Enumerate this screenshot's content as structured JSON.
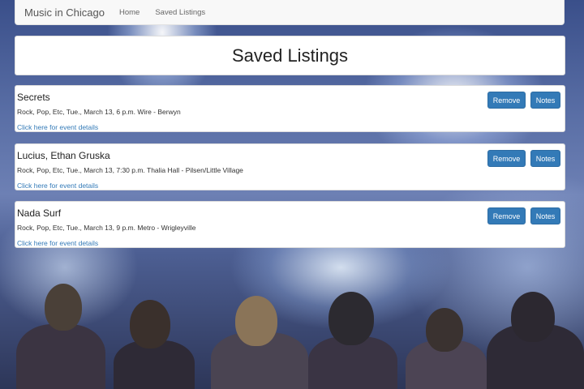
{
  "navbar": {
    "brand": "Music in Chicago",
    "links": [
      "Home",
      "Saved Listings"
    ]
  },
  "page_title": "Saved Listings",
  "listings": [
    {
      "name": "Secrets",
      "details": "Rock, Pop, Etc, Tue., March 13, 6 p.m. Wire - Berwyn",
      "link_text": "Click here for event details",
      "remove_label": "Remove",
      "notes_label": "Notes"
    },
    {
      "name": "Lucius, Ethan Gruska",
      "details": "Rock, Pop, Etc, Tue., March 13, 7:30 p.m. Thalia Hall - Pilsen/Little Village",
      "link_text": "Click here for event details",
      "remove_label": "Remove",
      "notes_label": "Notes"
    },
    {
      "name": "Nada Surf",
      "details": "Rock, Pop, Etc, Tue., March 13, 9 p.m. Metro - Wrigleyville",
      "link_text": "Click here for event details",
      "remove_label": "Remove",
      "notes_label": "Notes"
    }
  ],
  "colors": {
    "button_primary": "#337ab7",
    "link": "#337ab7",
    "navbar_bg": "#f8f8f8"
  }
}
